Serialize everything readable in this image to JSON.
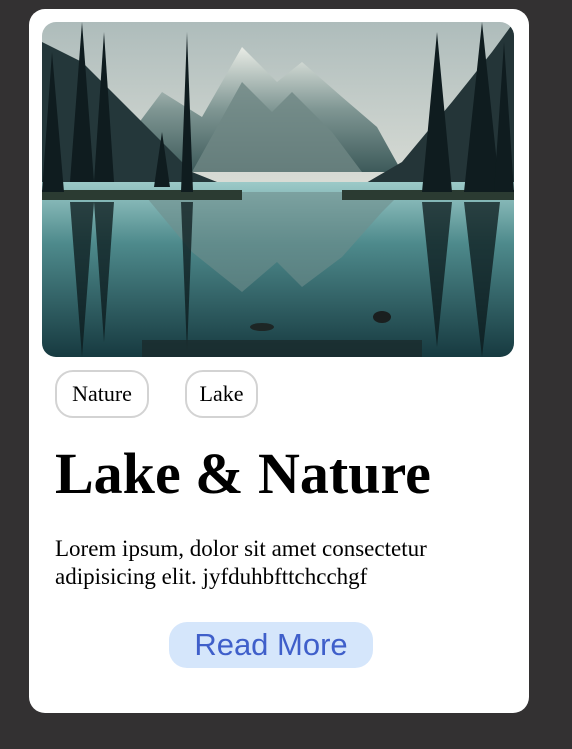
{
  "card": {
    "image_alt": "lake-landscape-image",
    "tags": [
      "Nature",
      "Lake"
    ],
    "title": "Lake & Nature",
    "description": "Lorem ipsum, dolor sit amet consectetur adipisicing elit. jyfduhbfttchcchgf",
    "button_label": "Read More"
  },
  "colors": {
    "page_background": "#333132",
    "card_background": "#ffffff",
    "tag_border": "#d3d3d3",
    "button_background": "#d5e6fb",
    "button_text": "#3f5fca"
  }
}
